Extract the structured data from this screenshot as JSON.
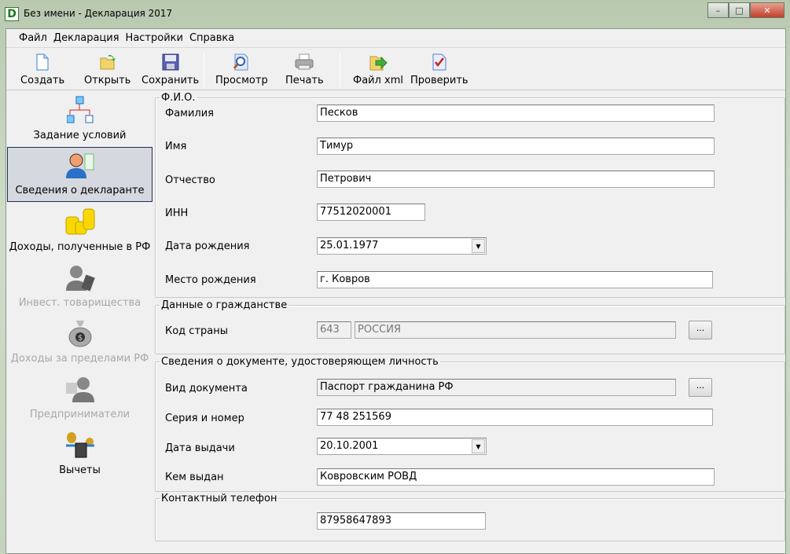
{
  "window": {
    "title": "Без имени - Декларация 2017",
    "app_icon": "D",
    "minimize": "–",
    "maximize": "□",
    "close": "✕"
  },
  "menu": [
    "Файл",
    "Декларация",
    "Настройки",
    "Справка"
  ],
  "toolbar": [
    {
      "label": "Создать",
      "icon": "new-document-icon"
    },
    {
      "label": "Открыть",
      "icon": "open-folder-icon"
    },
    {
      "label": "Сохранить",
      "icon": "floppy-disk-icon"
    },
    {
      "label": "Просмотр",
      "icon": "preview-magnifier-icon"
    },
    {
      "label": "Печать",
      "icon": "printer-icon"
    },
    {
      "label": "Файл xml",
      "icon": "xml-export-icon"
    },
    {
      "label": "Проверить",
      "icon": "check-document-icon"
    }
  ],
  "sidebar": [
    {
      "label": "Задание условий",
      "state": "normal"
    },
    {
      "label": "Сведения о декларанте",
      "state": "selected"
    },
    {
      "label": "Доходы, полученные в РФ",
      "state": "normal"
    },
    {
      "label": "Инвест. товарищества",
      "state": "disabled"
    },
    {
      "label": "Доходы за пределами РФ",
      "state": "disabled"
    },
    {
      "label": "Предприниматели",
      "state": "disabled"
    },
    {
      "label": "Вычеты",
      "state": "normal"
    }
  ],
  "fio": {
    "legend": "Ф.И.О.",
    "last_name_label": "Фамилия",
    "last_name": "Песков",
    "first_name_label": "Имя",
    "first_name": "Тимур",
    "patronymic_label": "Отчество",
    "patronymic": "Петрович",
    "inn_label": "ИНН",
    "inn": "77512020001",
    "birth_date_label": "Дата рождения",
    "birth_date": "25.01.1977",
    "birth_place_label": "Место рождения",
    "birth_place": "г. Ковров"
  },
  "citizenship": {
    "legend": "Данные о гражданстве",
    "country_code_label": "Код страны",
    "country_code": "643",
    "country_name": "РОССИЯ",
    "browse": "..."
  },
  "document": {
    "legend": "Сведения о документе, удостоверяющем личность",
    "type_label": "Вид документа",
    "type": "Паспорт гражданина РФ",
    "browse": "...",
    "number_label": "Серия и номер",
    "number": "77 48 251569",
    "issue_date_label": "Дата выдачи",
    "issue_date": "20.10.2001",
    "issued_by_label": "Кем выдан",
    "issued_by": "Ковровским РОВД"
  },
  "contact": {
    "legend": "Контактный телефон",
    "phone": "87958647893"
  },
  "dropdown_arrow": "▼"
}
